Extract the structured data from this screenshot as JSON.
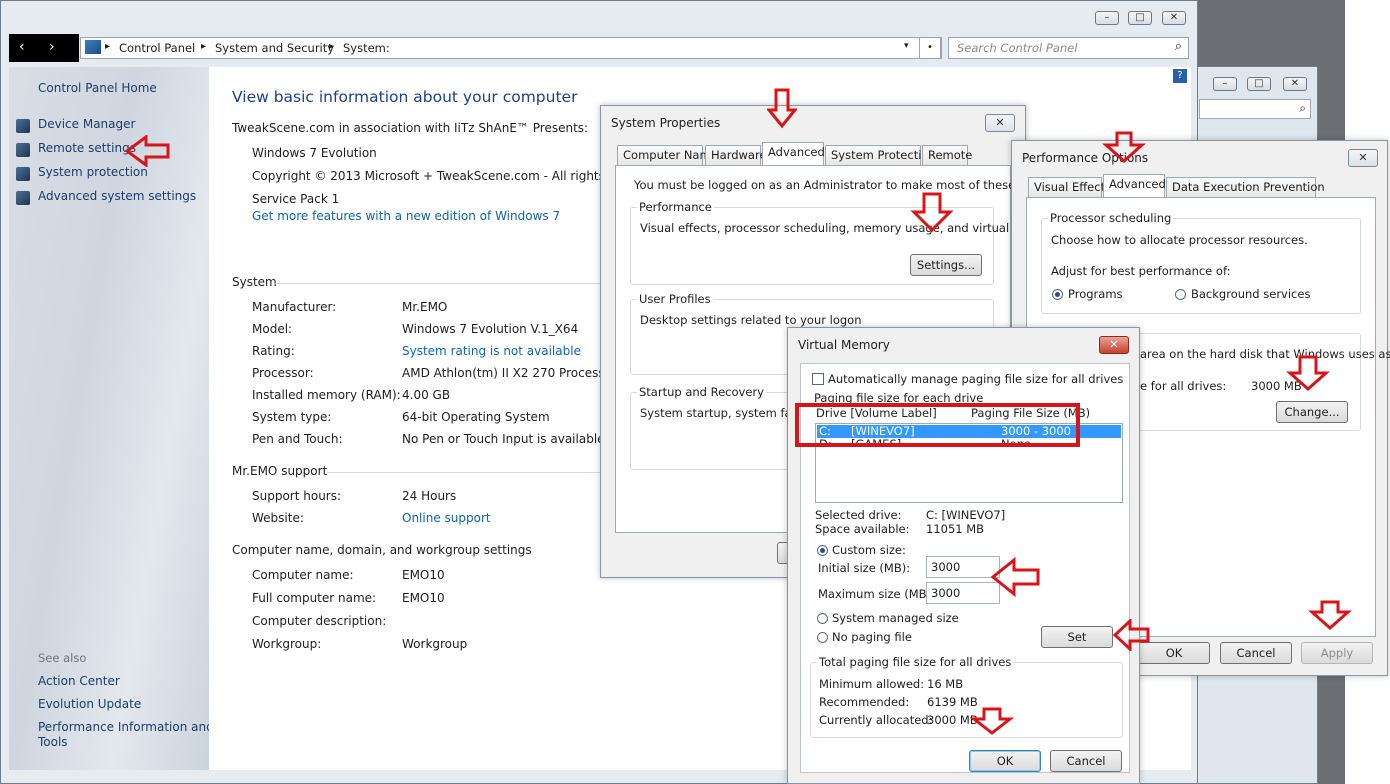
{
  "main_window": {
    "breadcrumb": [
      "Control Panel",
      "System and Security",
      "System:"
    ],
    "search_placeholder": "Search Control Panel",
    "help_label": "?",
    "sidebar": {
      "home": "Control Panel Home",
      "items": [
        "Device Manager",
        "Remote settings",
        "System protection",
        "Advanced system settings"
      ],
      "see_also_label": "See also",
      "see_also": [
        "Action Center",
        "Evolution Update",
        "Performance Information and",
        "Tools"
      ]
    },
    "heading": "View basic information about your computer",
    "presents": "TweakScene.com in association with IiTz ShAnE™ Presents:",
    "edition": "Windows 7 Evolution",
    "copyright": "Copyright © 2013 Microsoft + TweakScene.com -  All rights reserv",
    "service_pack": "Service Pack 1",
    "get_more_link": "Get more features with a new edition of Windows 7",
    "system_section": "System",
    "system_rows": [
      {
        "label": "Manufacturer:",
        "value": "Mr.EMO"
      },
      {
        "label": "Model:",
        "value": "Windows 7 Evolution V.1_X64"
      },
      {
        "label": "Rating:",
        "value": "System rating is not available"
      },
      {
        "label": "Processor:",
        "value": "AMD Athlon(tm) II X2 270 Processor"
      },
      {
        "label": "Installed memory (RAM):",
        "value": "4.00 GB"
      },
      {
        "label": "System type:",
        "value": "64-bit Operating System"
      },
      {
        "label": "Pen and Touch:",
        "value": "No Pen or Touch Input is available for"
      }
    ],
    "support_section": "Mr.EMO support",
    "support_rows": [
      {
        "label": "Support hours:",
        "value": "24 Hours"
      },
      {
        "label": "Website:",
        "value": "Online support"
      }
    ],
    "computer_section": "Computer name, domain, and workgroup settings",
    "computer_rows": [
      {
        "label": "Computer name:",
        "value": "EMO10"
      },
      {
        "label": "Full computer name:",
        "value": "EMO10"
      },
      {
        "label": "Computer description:",
        "value": ""
      },
      {
        "label": "Workgroup:",
        "value": "Workgroup"
      }
    ]
  },
  "system_properties": {
    "title": "System Properties",
    "tabs": [
      "Computer Name",
      "Hardware",
      "Advanced",
      "System Protection",
      "Remote"
    ],
    "admin_note": "You must be logged on as an Administrator to make most of these changes.",
    "performance_label": "Performance",
    "performance_desc": "Visual effects, processor scheduling, memory usage, and virtual memory",
    "settings_button": "Settings...",
    "profiles_label": "User Profiles",
    "profiles_desc": "Desktop settings related to your logon",
    "startup_label": "Startup and Recovery",
    "startup_desc": "System startup, system failure, a"
  },
  "performance_options": {
    "title": "Performance Options",
    "tabs": [
      "Visual Effects",
      "Advanced",
      "Data Execution Prevention"
    ],
    "sched_label": "Processor scheduling",
    "sched_desc": "Choose how to allocate processor resources.",
    "adjust_label": "Adjust for best performance of:",
    "radio_programs": "Programs",
    "radio_background": "Background services",
    "vm_desc_partial": "area on the hard disk that Windows uses as",
    "vm_total_partial": "e for all drives:",
    "vm_total_value": "3000 MB",
    "change_button": "Change...",
    "ok": "OK",
    "cancel": "Cancel",
    "apply": "Apply"
  },
  "virtual_memory": {
    "title": "Virtual Memory",
    "auto_manage": "Automatically manage paging file size for all drives",
    "paging_label": "Paging file size for each drive",
    "col_drive": "Drive  [Volume Label]",
    "col_size": "Paging File Size (MB)",
    "drives": [
      {
        "drive": "C:",
        "label": "[WINEVO7]",
        "size": "3000 - 3000"
      },
      {
        "drive": "D:",
        "label": "[GAMES]",
        "size": "None"
      }
    ],
    "selected_drive_label": "Selected drive:",
    "selected_drive_value": "C:  [WINEVO7]",
    "space_label": "Space available:",
    "space_value": "11051 MB",
    "custom_size": "Custom size:",
    "initial_label": "Initial size (MB):",
    "initial_value": "3000",
    "max_label": "Maximum size (MB):",
    "max_value": "3000",
    "system_managed": "System managed size",
    "no_paging": "No paging file",
    "set_button": "Set",
    "total_label": "Total paging file size for all drives",
    "min_label": "Minimum allowed:",
    "min_value": "16 MB",
    "rec_label": "Recommended:",
    "rec_value": "6139 MB",
    "alloc_label": "Currently allocated:",
    "alloc_value": "3000 MB",
    "ok": "OK",
    "cancel": "Cancel"
  },
  "colors": {
    "accent_arrow": "#d8141a",
    "link": "#0e63b3",
    "highlight": "#3399ff"
  }
}
